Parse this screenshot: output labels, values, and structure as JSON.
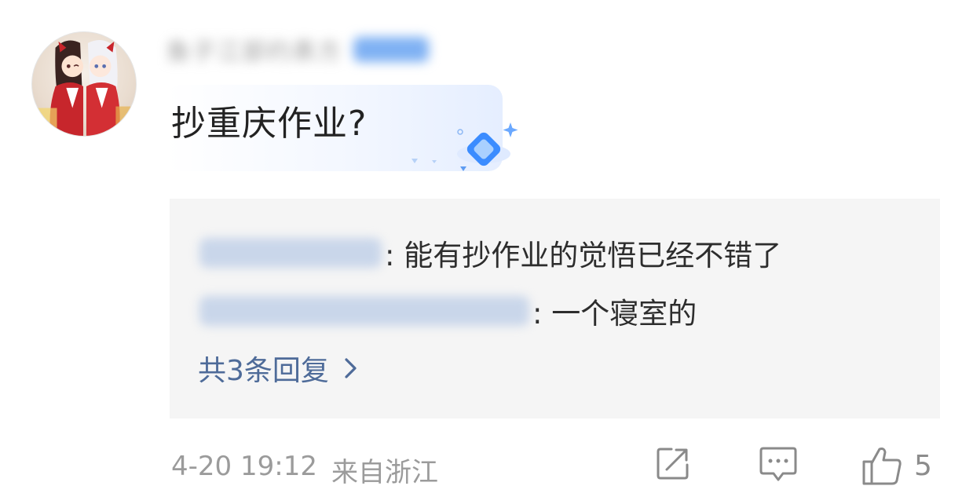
{
  "comment": {
    "username": "鱼子江部约表方",
    "text": "抄重庆作业?"
  },
  "replies": {
    "items": [
      {
        "author": "",
        "text": "能有抄作业的觉悟已经不错了"
      },
      {
        "author": "",
        "text": "一个寝室的"
      }
    ],
    "more_label": "共3条回复"
  },
  "footer": {
    "time": "4-20 19:12",
    "location": "来自浙江",
    "like_count": "5"
  },
  "icons": {
    "share": "share-icon",
    "reply": "comment-icon",
    "like": "thumbs-up-icon",
    "chevron": "chevron-right-icon"
  },
  "colors": {
    "link": "#4e6b99",
    "reply_bg": "#f5f5f5",
    "meta_text": "#9b9b9b"
  }
}
